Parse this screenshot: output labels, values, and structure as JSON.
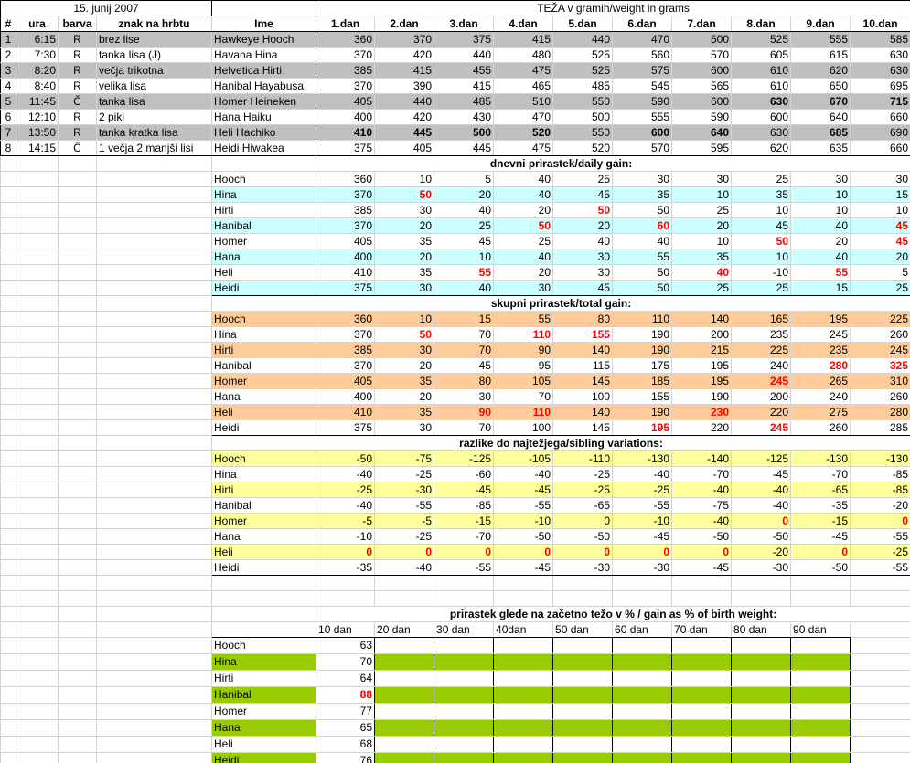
{
  "header": {
    "date": "15. junij 2007",
    "weight_title": "TEŽA v gramih/weight in grams",
    "cols": [
      "#",
      "ura",
      "barva",
      "znak na hrbtu",
      "Ime",
      "1.dan",
      "2.dan",
      "3.dan",
      "4.dan",
      "5.dan",
      "6.dan",
      "7.dan",
      "8.dan",
      "9.dan",
      "10.dan"
    ]
  },
  "kittens": [
    {
      "n": "1",
      "ura": "6:15",
      "barva": "R",
      "znak": "brez lise",
      "ime": "Hawkeye Hooch",
      "w": [
        "360",
        "370",
        "375",
        "415",
        "440",
        "470",
        "500",
        "525",
        "555",
        "585"
      ],
      "bold": []
    },
    {
      "n": "2",
      "ura": "7:30",
      "barva": "R",
      "znak": "tanka lisa (J)",
      "ime": "Havana Hina",
      "w": [
        "370",
        "420",
        "440",
        "480",
        "525",
        "560",
        "570",
        "605",
        "615",
        "630"
      ],
      "bold": []
    },
    {
      "n": "3",
      "ura": "8:20",
      "barva": "R",
      "znak": "večja trikotna",
      "ime": "Helvetica Hirti",
      "w": [
        "385",
        "415",
        "455",
        "475",
        "525",
        "575",
        "600",
        "610",
        "620",
        "630"
      ],
      "bold": []
    },
    {
      "n": "4",
      "ura": "8:40",
      "barva": "R",
      "znak": "velika lisa",
      "ime": "Hanibal Hayabusa",
      "w": [
        "370",
        "390",
        "415",
        "465",
        "485",
        "545",
        "565",
        "610",
        "650",
        "695"
      ],
      "bold": []
    },
    {
      "n": "5",
      "ura": "11:45",
      "barva": "Č",
      "znak": "tanka lisa",
      "ime": "Homer Heineken",
      "w": [
        "405",
        "440",
        "485",
        "510",
        "550",
        "590",
        "600",
        "630",
        "670",
        "715"
      ],
      "bold": [
        7,
        8,
        9
      ]
    },
    {
      "n": "6",
      "ura": "12:10",
      "barva": "R",
      "znak": "2 piki",
      "ime": "Hana Haiku",
      "w": [
        "400",
        "420",
        "430",
        "470",
        "500",
        "555",
        "590",
        "600",
        "640",
        "660"
      ],
      "bold": []
    },
    {
      "n": "7",
      "ura": "13:50",
      "barva": "R",
      "znak": "tanka kratka lisa",
      "ime": "Heli Hachiko",
      "w": [
        "410",
        "445",
        "500",
        "520",
        "550",
        "600",
        "640",
        "630",
        "685",
        "690"
      ],
      "bold": [
        0,
        1,
        2,
        3,
        5,
        6,
        8
      ]
    },
    {
      "n": "8",
      "ura": "14:15",
      "barva": "Č",
      "znak": "1 večja  2 manjši lisi",
      "ime": "Heidi Hiwakea",
      "w": [
        "375",
        "405",
        "445",
        "475",
        "520",
        "570",
        "595",
        "620",
        "635",
        "660"
      ],
      "bold": []
    }
  ],
  "daily": {
    "title": "dnevni prirastek/daily gain:",
    "rows": [
      {
        "ime": "Hooch",
        "v": [
          "360",
          "10",
          "5",
          "40",
          "25",
          "30",
          "30",
          "25",
          "30",
          "30"
        ],
        "red": []
      },
      {
        "ime": "Hina",
        "v": [
          "370",
          "50",
          "20",
          "40",
          "45",
          "35",
          "10",
          "35",
          "10",
          "15"
        ],
        "red": [
          1
        ]
      },
      {
        "ime": "Hirti",
        "v": [
          "385",
          "30",
          "40",
          "20",
          "50",
          "50",
          "25",
          "10",
          "10",
          "10"
        ],
        "red": [
          4
        ]
      },
      {
        "ime": "Hanibal",
        "v": [
          "370",
          "20",
          "25",
          "50",
          "20",
          "60",
          "20",
          "45",
          "40",
          "45"
        ],
        "red": [
          3,
          5,
          9
        ]
      },
      {
        "ime": "Homer",
        "v": [
          "405",
          "35",
          "45",
          "25",
          "40",
          "40",
          "10",
          "50",
          "20",
          "45"
        ],
        "red": [
          7,
          9
        ]
      },
      {
        "ime": "Hana",
        "v": [
          "400",
          "20",
          "10",
          "40",
          "30",
          "55",
          "35",
          "10",
          "40",
          "20"
        ],
        "red": []
      },
      {
        "ime": "Heli",
        "v": [
          "410",
          "35",
          "55",
          "20",
          "30",
          "50",
          "40",
          "-10",
          "55",
          "5"
        ],
        "red": [
          2,
          6,
          8
        ]
      },
      {
        "ime": "Heidi",
        "v": [
          "375",
          "30",
          "40",
          "30",
          "45",
          "50",
          "25",
          "25",
          "15",
          "25"
        ],
        "red": []
      }
    ]
  },
  "total": {
    "title": "skupni prirastek/total gain:",
    "rows": [
      {
        "ime": "Hooch",
        "v": [
          "360",
          "10",
          "15",
          "55",
          "80",
          "110",
          "140",
          "165",
          "195",
          "225"
        ],
        "red": []
      },
      {
        "ime": "Hina",
        "v": [
          "370",
          "50",
          "70",
          "110",
          "155",
          "190",
          "200",
          "235",
          "245",
          "260"
        ],
        "red": [
          1,
          3,
          4
        ]
      },
      {
        "ime": "Hirti",
        "v": [
          "385",
          "30",
          "70",
          "90",
          "140",
          "190",
          "215",
          "225",
          "235",
          "245"
        ],
        "red": []
      },
      {
        "ime": "Hanibal",
        "v": [
          "370",
          "20",
          "45",
          "95",
          "115",
          "175",
          "195",
          "240",
          "280",
          "325"
        ],
        "red": [
          8,
          9
        ]
      },
      {
        "ime": "Homer",
        "v": [
          "405",
          "35",
          "80",
          "105",
          "145",
          "185",
          "195",
          "245",
          "265",
          "310"
        ],
        "red": [
          7
        ]
      },
      {
        "ime": "Hana",
        "v": [
          "400",
          "20",
          "30",
          "70",
          "100",
          "155",
          "190",
          "200",
          "240",
          "260"
        ],
        "red": []
      },
      {
        "ime": "Heli",
        "v": [
          "410",
          "35",
          "90",
          "110",
          "140",
          "190",
          "230",
          "220",
          "275",
          "280"
        ],
        "red": [
          2,
          3,
          6
        ]
      },
      {
        "ime": "Heidi",
        "v": [
          "375",
          "30",
          "70",
          "100",
          "145",
          "195",
          "220",
          "245",
          "260",
          "285"
        ],
        "red": [
          5,
          7
        ]
      }
    ]
  },
  "variation": {
    "title": "razlike do najtežjega/sibling variations:",
    "rows": [
      {
        "ime": "Hooch",
        "v": [
          "-50",
          "-75",
          "-125",
          "-105",
          "-110",
          "-130",
          "-140",
          "-125",
          "-130",
          "-130"
        ],
        "red": []
      },
      {
        "ime": "Hina",
        "v": [
          "-40",
          "-25",
          "-60",
          "-40",
          "-25",
          "-40",
          "-70",
          "-45",
          "-70",
          "-85"
        ],
        "red": []
      },
      {
        "ime": "Hirti",
        "v": [
          "-25",
          "-30",
          "-45",
          "-45",
          "-25",
          "-25",
          "-40",
          "-40",
          "-65",
          "-85"
        ],
        "red": []
      },
      {
        "ime": "Hanibal",
        "v": [
          "-40",
          "-55",
          "-85",
          "-55",
          "-65",
          "-55",
          "-75",
          "-40",
          "-35",
          "-20"
        ],
        "red": []
      },
      {
        "ime": "Homer",
        "v": [
          "-5",
          "-5",
          "-15",
          "-10",
          "0",
          "-10",
          "-40",
          "0",
          "-15",
          "0"
        ],
        "red": [
          7,
          9
        ]
      },
      {
        "ime": "Hana",
        "v": [
          "-10",
          "-25",
          "-70",
          "-50",
          "-50",
          "-45",
          "-50",
          "-50",
          "-45",
          "-55"
        ],
        "red": []
      },
      {
        "ime": "Heli",
        "v": [
          "0",
          "0",
          "0",
          "0",
          "0",
          "0",
          "0",
          "-20",
          "0",
          "-25"
        ],
        "red": [
          0,
          1,
          2,
          3,
          4,
          5,
          6,
          8
        ]
      },
      {
        "ime": "Heidi",
        "v": [
          "-35",
          "-40",
          "-55",
          "-45",
          "-30",
          "-30",
          "-45",
          "-30",
          "-50",
          "-55"
        ],
        "red": []
      }
    ]
  },
  "percent": {
    "title": "prirastek glede na začetno težo v % / gain as % of birth weight:",
    "cols": [
      "10 dan",
      "20 dan",
      "30 dan",
      "40dan",
      "50 dan",
      "60 dan",
      "70 dan",
      "80 dan",
      "90 dan"
    ],
    "rows": [
      {
        "ime": "Hooch",
        "v": "63",
        "red": false
      },
      {
        "ime": "Hina",
        "v": "70",
        "red": false
      },
      {
        "ime": "Hirti",
        "v": "64",
        "red": false
      },
      {
        "ime": "Hanibal",
        "v": "88",
        "red": true
      },
      {
        "ime": "Homer",
        "v": "77",
        "red": false
      },
      {
        "ime": "Hana",
        "v": "65",
        "red": false
      },
      {
        "ime": "Heli",
        "v": "68",
        "red": false
      },
      {
        "ime": "Heidi",
        "v": "76",
        "red": false
      }
    ]
  }
}
